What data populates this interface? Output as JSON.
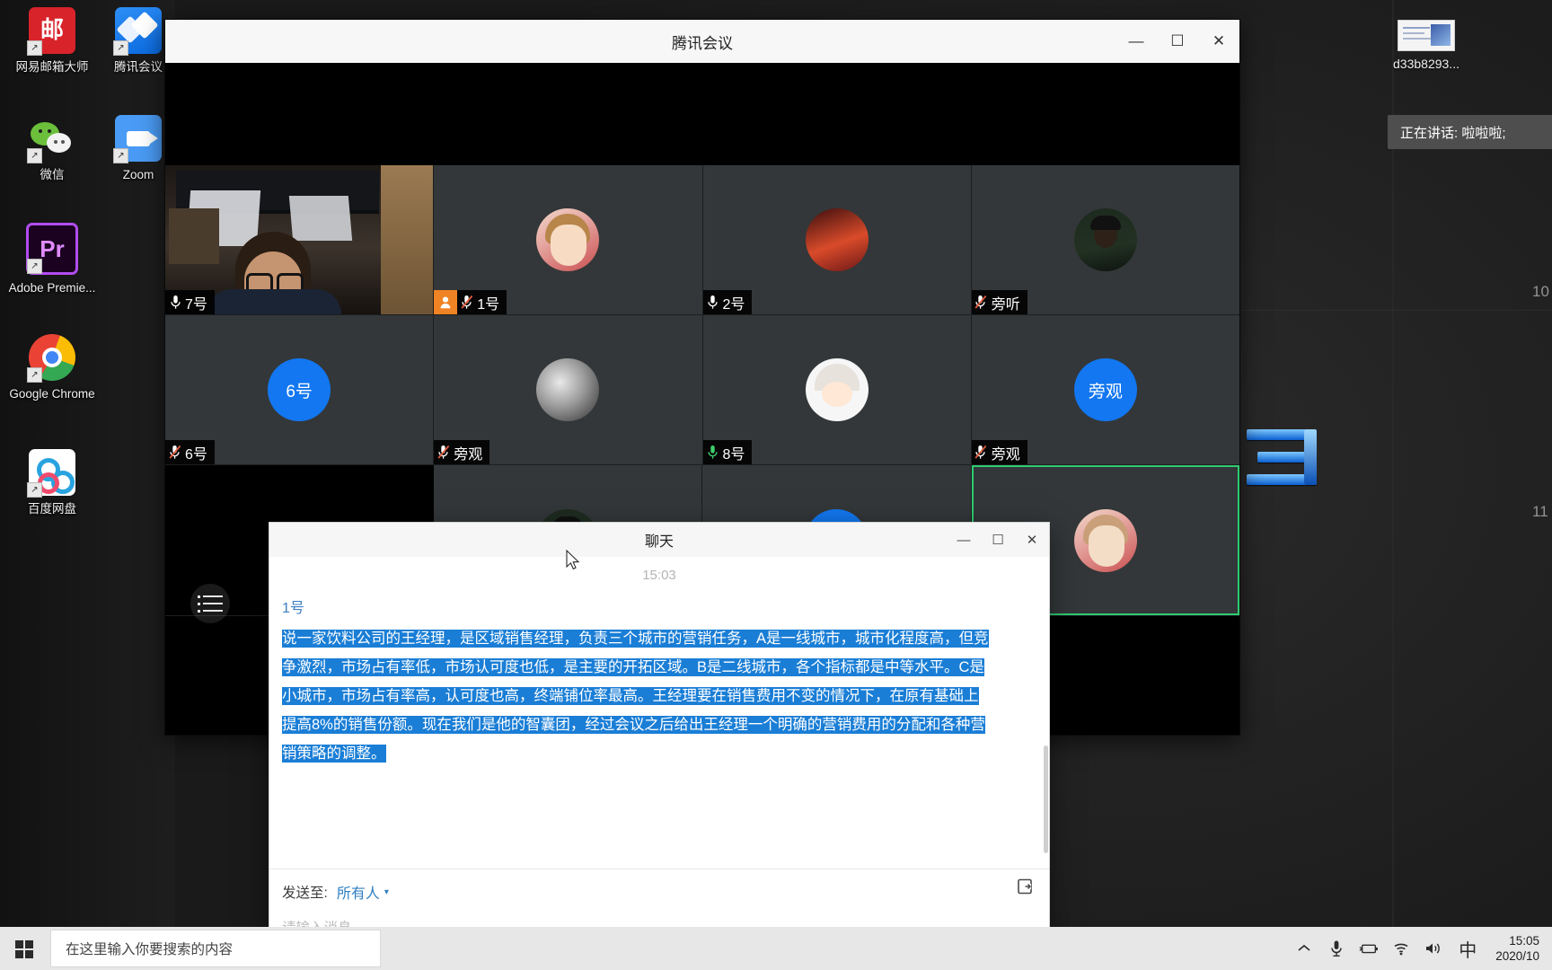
{
  "desktop": {
    "icons": [
      {
        "name": "netease-mail-master",
        "label": "网易邮箱大师",
        "glyph": "邮"
      },
      {
        "name": "tencent-meeting",
        "label": "腾讯会议",
        "glyph": ""
      },
      {
        "name": "wechat",
        "label": "微信",
        "glyph": ""
      },
      {
        "name": "zoom",
        "label": "Zoom",
        "glyph": ""
      },
      {
        "name": "adobe-premiere",
        "label": "Adobe Premie...",
        "glyph": "Pr"
      },
      {
        "name": "google-chrome",
        "label": "Google Chrome",
        "glyph": ""
      },
      {
        "name": "baidu-netdisk",
        "label": "百度网盘",
        "glyph": ""
      }
    ],
    "file_item": {
      "label": "d33b8293..."
    },
    "wall_numbers": [
      "10",
      "11"
    ]
  },
  "toast": {
    "text": "正在讲话: 啦啦啦;"
  },
  "meeting": {
    "title": "腾讯会议",
    "window_buttons": {
      "minimize": "—",
      "maximize": "☐",
      "close": "✕"
    },
    "grid": [
      [
        {
          "label": "7号",
          "mic": "on",
          "host": false,
          "avatar": "video",
          "active": false
        },
        {
          "label": "1号",
          "mic": "muted",
          "host": true,
          "avatar": "anime",
          "active": false
        },
        {
          "label": "2号",
          "mic": "on",
          "host": false,
          "avatar": "red",
          "active": false
        },
        {
          "label": "旁听",
          "mic": "muted",
          "host": false,
          "avatar": "person",
          "active": false
        }
      ],
      [
        {
          "label": "6号",
          "mic": "muted",
          "host": false,
          "avatar": "blue",
          "avatar_text": "6号",
          "active": false
        },
        {
          "label": "旁观",
          "mic": "muted",
          "host": false,
          "avatar": "moon",
          "active": false
        },
        {
          "label": "8号",
          "mic": "on",
          "host": false,
          "avatar": "chibi",
          "active": false
        },
        {
          "label": "旁观",
          "mic": "muted",
          "host": false,
          "avatar": "blue",
          "avatar_text": "旁观",
          "active": false
        }
      ],
      [
        {
          "label": "",
          "mic": "none",
          "host": false,
          "avatar": "none",
          "active": false
        },
        {
          "label": "",
          "mic": "none",
          "host": false,
          "avatar": "person",
          "active": false
        },
        {
          "label": "",
          "mic": "none",
          "host": false,
          "avatar": "blue",
          "avatar_text": "",
          "active": false
        },
        {
          "label": "",
          "mic": "none",
          "host": false,
          "avatar": "anime",
          "active": true
        }
      ]
    ]
  },
  "chat": {
    "title": "聊天",
    "window_buttons": {
      "minimize": "—",
      "maximize": "☐",
      "close": "✕"
    },
    "timestamp": "15:03",
    "messages": [
      {
        "sender": "1号",
        "text": "说一家饮料公司的王经理，是区域销售经理，负责三个城市的营销任务，A是一线城市，城市化程度高，但竞争激烈，市场占有率低，市场认可度也低，是主要的开拓区域。B是二线城市，各个指标都是中等水平。C是小城市，市场占有率高，认可度也高，终端铺位率最高。王经理要在销售费用不变的情况下，在原有基础上提高8%的销售份额。现在我们是他的智囊团，经过会议之后给出王经理一个明确的营销费用的分配和各种营销策略的调整。"
      }
    ],
    "send_to_label": "发送至:",
    "send_to_value": "所有人",
    "input_placeholder": "请输入消息..."
  },
  "taskbar": {
    "search_placeholder": "在这里输入你要搜索的内容",
    "tray_icons": [
      "chevron-up-icon",
      "microphone-icon",
      "battery-icon",
      "wifi-icon",
      "volume-icon"
    ],
    "ime": "中",
    "clock_time": "15:05",
    "clock_date": "2020/10"
  }
}
